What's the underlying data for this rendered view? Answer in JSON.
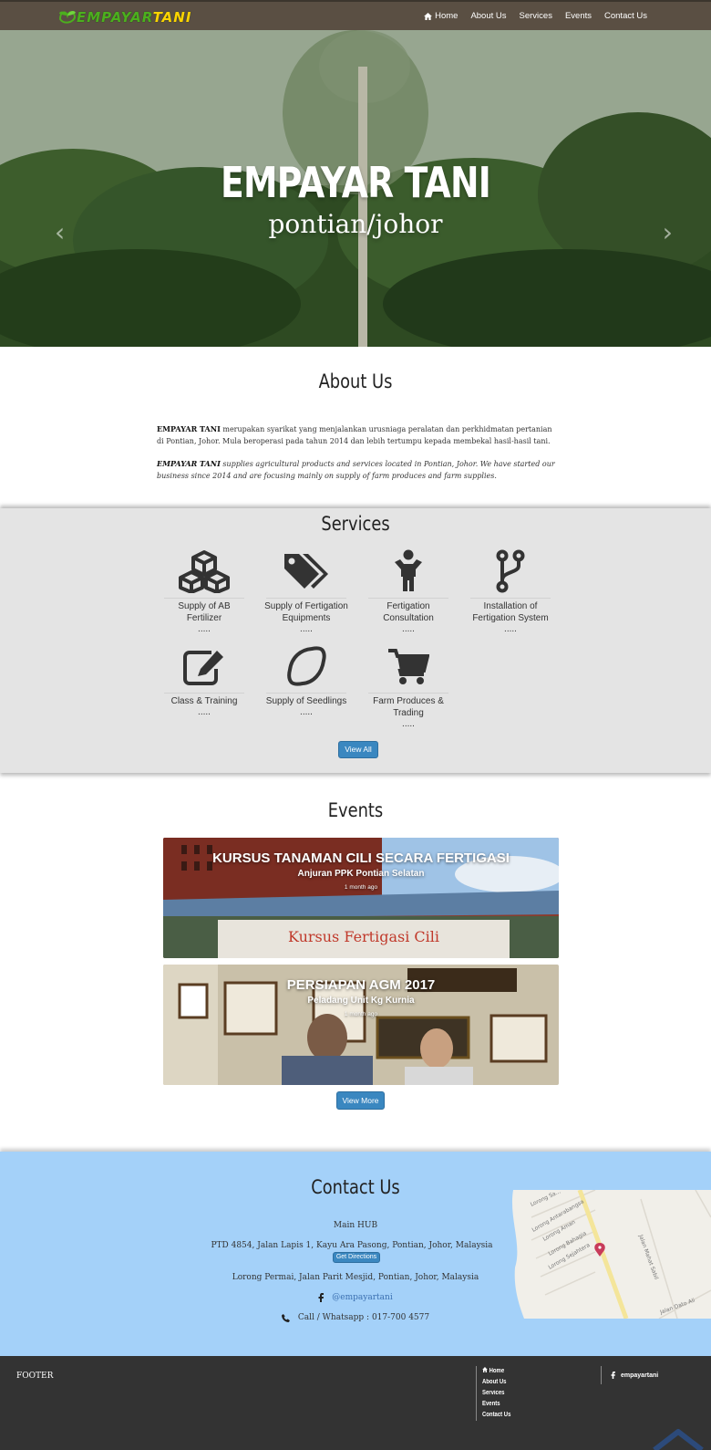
{
  "nav": {
    "logo_main": "EMPAYAR",
    "logo_accent": "TANI",
    "links": [
      {
        "label": "Home",
        "icon": "home-icon"
      },
      {
        "label": "About Us"
      },
      {
        "label": "Services"
      },
      {
        "label": "Events"
      },
      {
        "label": "Contact Us"
      }
    ]
  },
  "hero": {
    "title": "EMPAYAR TANI",
    "subtitle": "pontian/johor",
    "prev_arrow": "‹",
    "next_arrow": "›"
  },
  "about": {
    "title": "About Us",
    "p1_brand": "EMPAYAR TANI",
    "p1_text": " merupakan syarikat yang menjalankan urusniaga peralatan dan perkhidmatan pertanian di Pontian, Johor. Mula beroperasi pada tahun 2014 dan lebih tertumpu kepada membekal hasil-hasil tani.",
    "p2_brand": "EMPAYAR TANI",
    "p2_text": " supplies agricultural products and services located in Pontian, Johor. We have started our business since 2014 and are focusing mainly on supply of farm produces and farm supplies."
  },
  "services": {
    "title": "Services",
    "items": [
      {
        "name": "Supply of AB Fertilizer",
        "dots": ".....",
        "icon": "cubes-icon"
      },
      {
        "name": "Supply of Fertigation Equipments",
        "dots": ".....",
        "icon": "tags-icon"
      },
      {
        "name": "Fertigation Consultation",
        "dots": ".....",
        "icon": "child-icon"
      },
      {
        "name": "Installation of Fertigation System",
        "dots": ".....",
        "icon": "code-fork-icon"
      },
      {
        "name": "Class & Training",
        "dots": ".....",
        "icon": "edit-icon"
      },
      {
        "name": "Supply of Seedlings",
        "dots": ".....",
        "icon": "lemon-icon"
      },
      {
        "name": "Farm Produces & Trading",
        "dots": ".....",
        "icon": "cart-icon"
      }
    ],
    "view_all": "View All"
  },
  "events": {
    "title": "Events",
    "items": [
      {
        "title": "KURSUS TANAMAN CILI SECARA FERTIGASI",
        "subtitle": "Anjuran PPK Pontian Selatan",
        "time": "1 month ago",
        "banner_text": "Kursus Fertigasi Cili"
      },
      {
        "title": "PERSIAPAN AGM 2017",
        "subtitle": "Peladang Unit Kg Kurnia",
        "time": "1 month ago"
      }
    ],
    "view_more": "View More"
  },
  "contact": {
    "title": "Contact Us",
    "hub": "Main HUB",
    "address1": "PTD 4854, Jalan Lapis 1, Kayu Ara Pasong, Pontian, Johor, Malaysia",
    "directions": "Get Directions",
    "address2": "Lorong Permai, Jalan Parit Mesjid, Pontian, Johor, Malaysia",
    "facebook": "@empayartani",
    "phone": "Call / Whatsapp : 017-700 4577",
    "map_labels": [
      "Lorong Sa...",
      "Lorong Antarabangsa",
      "Lorong Aman",
      "Lorong Bahagia",
      "Lorong Sejahtera",
      "Jalan Mahat Sabil",
      "Jalan Dato Ali"
    ]
  },
  "footer": {
    "label": "FOOTER",
    "links": [
      "Home",
      "About Us",
      "Services",
      "Events",
      "Contact Us"
    ],
    "social": "empayartani"
  },
  "colors": {
    "navbar": "#5a4f43",
    "services_bg": "#e4e4e4",
    "contact_bg": "#a4d1f9",
    "footer_bg": "#333333",
    "button": "#3a87c0"
  }
}
